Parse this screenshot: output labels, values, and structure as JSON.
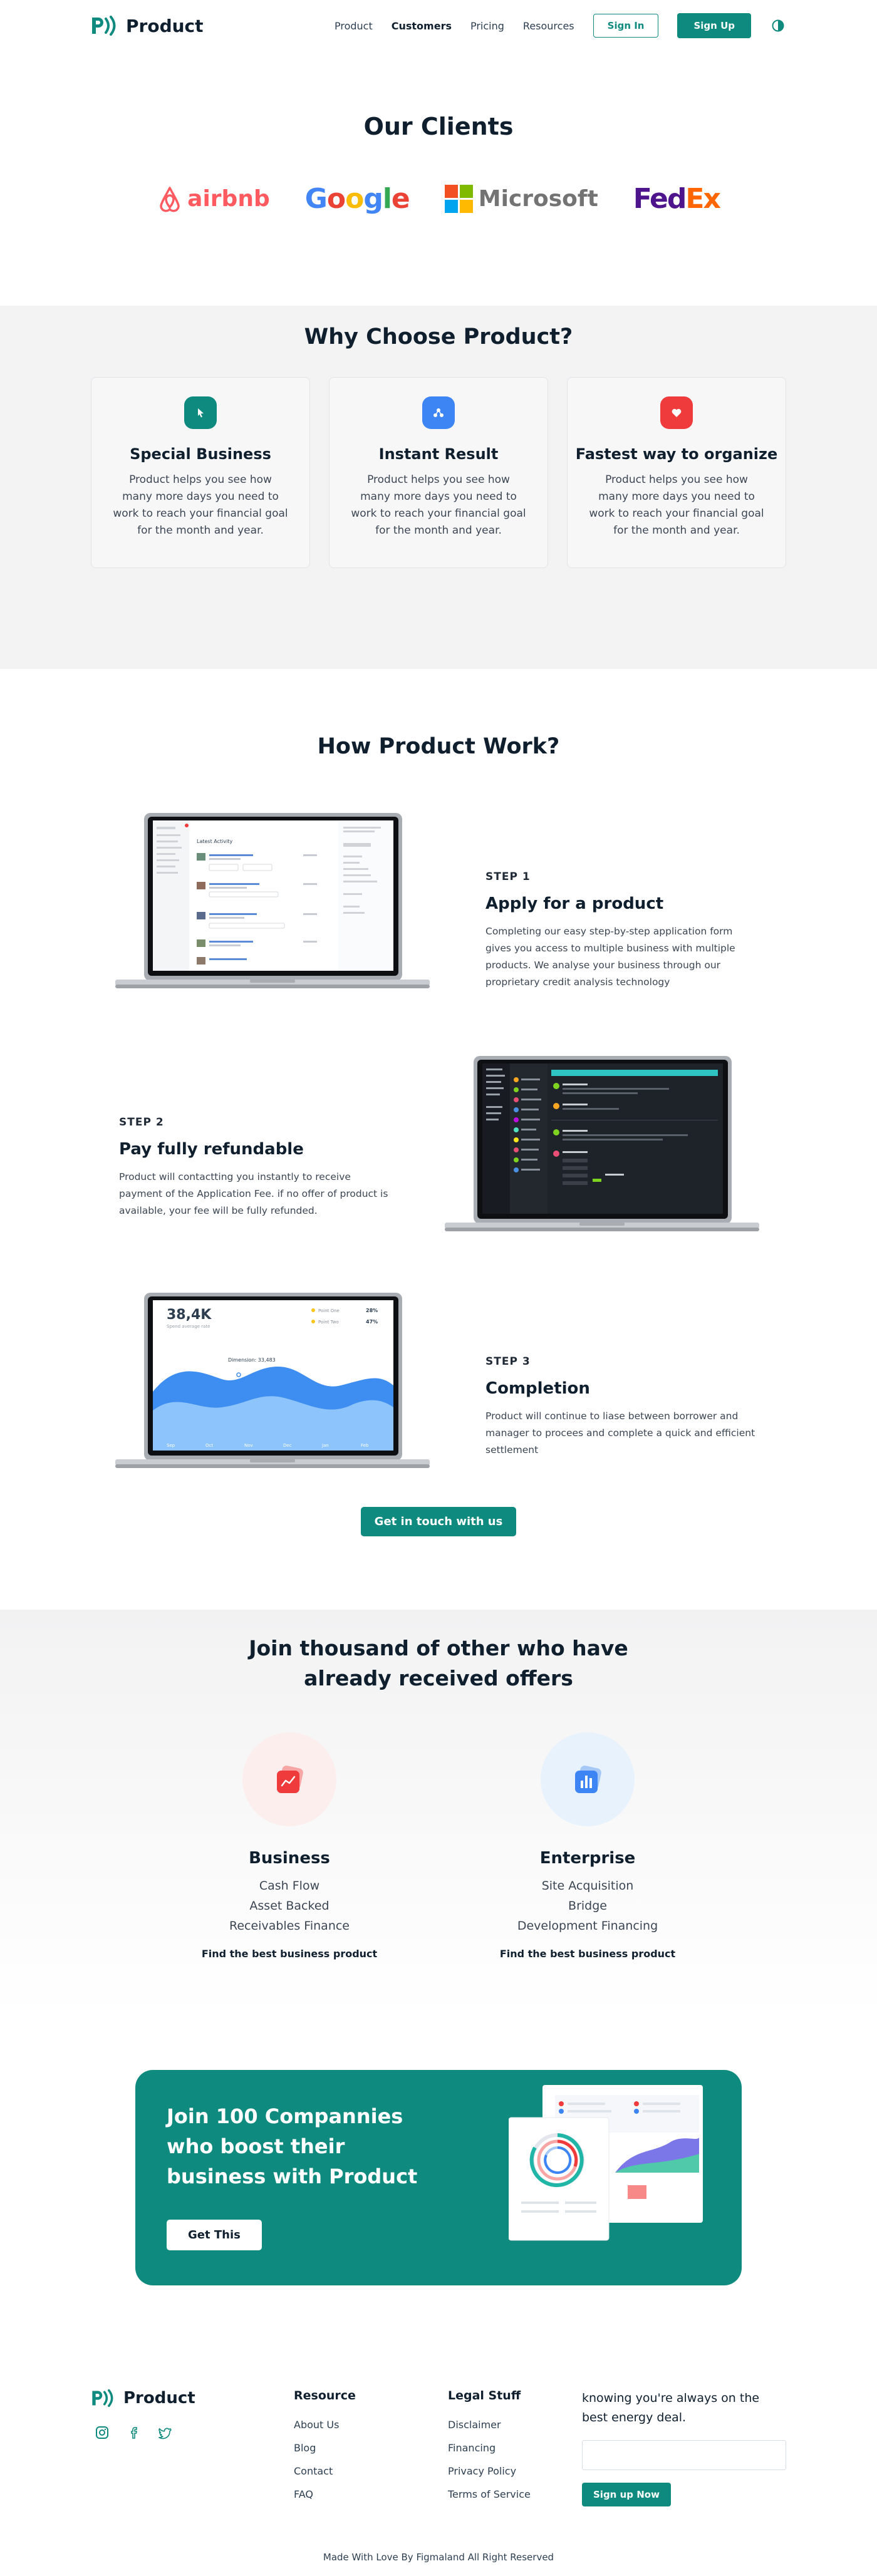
{
  "nav": {
    "brand": "Product",
    "links": [
      "Product",
      "Customers",
      "Pricing",
      "Resources"
    ],
    "signin": "Sign In",
    "signup": "Sign Up"
  },
  "clients": {
    "title": "Our Clients",
    "logos": [
      "airbnb",
      "Google",
      "Microsoft",
      "FedEx"
    ]
  },
  "why": {
    "title": "Why Choose Product?",
    "cards": [
      {
        "title": "Special Business",
        "text": "Product helps you see how many more days you need to work to reach your financial goal for the month and year.",
        "icon": "cursor-icon",
        "color": "#0f8a7e"
      },
      {
        "title": "Instant Result",
        "text": "Product helps you see how many more days you need to work to reach your financial goal for the month and year.",
        "icon": "nodes-icon",
        "color": "#3d85f5"
      },
      {
        "title": "Fastest way to organize",
        "text": "Product helps you see how many more days you need to work to reach your financial goal for the month and year.",
        "icon": "heart-icon",
        "color": "#ef3b3b"
      }
    ]
  },
  "how": {
    "title": "How Product Work?",
    "steps": [
      {
        "label": "STEP 1",
        "title": "Apply for a product",
        "text": "Completing our easy step-by-step application form gives you access to multiple business with multiple products. We analyse your business through our proprietary credit analysis technology"
      },
      {
        "label": "STEP 2",
        "title": "Pay fully refundable",
        "text": "Product will contactting you instantly to receive payment of the Application Fee. if no offer of product is available, your fee will be fully refunded."
      },
      {
        "label": "STEP 3",
        "title": "Completion",
        "text": "Product will continue to liase between borrower and manager to procees and complete a quick and efficient settlement"
      }
    ],
    "laptop1": {
      "heading": "Latest Activity"
    },
    "laptop3": {
      "value": "38,4K",
      "sub": "Spend average rate",
      "legend": [
        "Point One",
        "Point Two"
      ],
      "legend_values": [
        "28%",
        "47%"
      ],
      "tooltip": "Dimension: 33,483",
      "xlabels": [
        "Sep",
        "Oct",
        "Nov",
        "Dec",
        "Jan",
        "Feb"
      ]
    },
    "cta": "Get in touch with us"
  },
  "join": {
    "title_line1": "Join thousand of other who have",
    "title_line2": "already received offers",
    "plans": [
      {
        "title": "Business",
        "items": [
          "Cash Flow",
          "Asset Backed",
          "Receivables Finance"
        ],
        "link": "Find the best business product",
        "icon": "trend-icon",
        "bg": "#fdeeee",
        "color": "#ef3b3b"
      },
      {
        "title": "Enterprise",
        "items": [
          "Site Acquisition",
          "Bridge",
          "Development Financing"
        ],
        "link": "Find the best business product",
        "icon": "bars-icon",
        "bg": "#e8f2fd",
        "color": "#3d85f5"
      }
    ]
  },
  "banner": {
    "title": "Join 100 Compannies who boost their business with Product",
    "button": "Get This"
  },
  "footer": {
    "brand": "Product",
    "resource_head": "Resource",
    "resource_links": [
      "About Us",
      "Blog",
      "Contact",
      "FAQ"
    ],
    "legal_head": "Legal Stuff",
    "legal_links": [
      "Disclaimer",
      "Financing",
      "Privacy Policy",
      "Terms of Service"
    ],
    "news_text": "knowing you're always on the best energy deal.",
    "news_button": "Sign up Now",
    "copyright": "Made With Love By Figmaland All Right Reserved"
  },
  "colors": {
    "primary": "#0f8a7e",
    "dark": "#0f1f2e",
    "red": "#ef3b3b",
    "blue": "#3d85f5"
  }
}
